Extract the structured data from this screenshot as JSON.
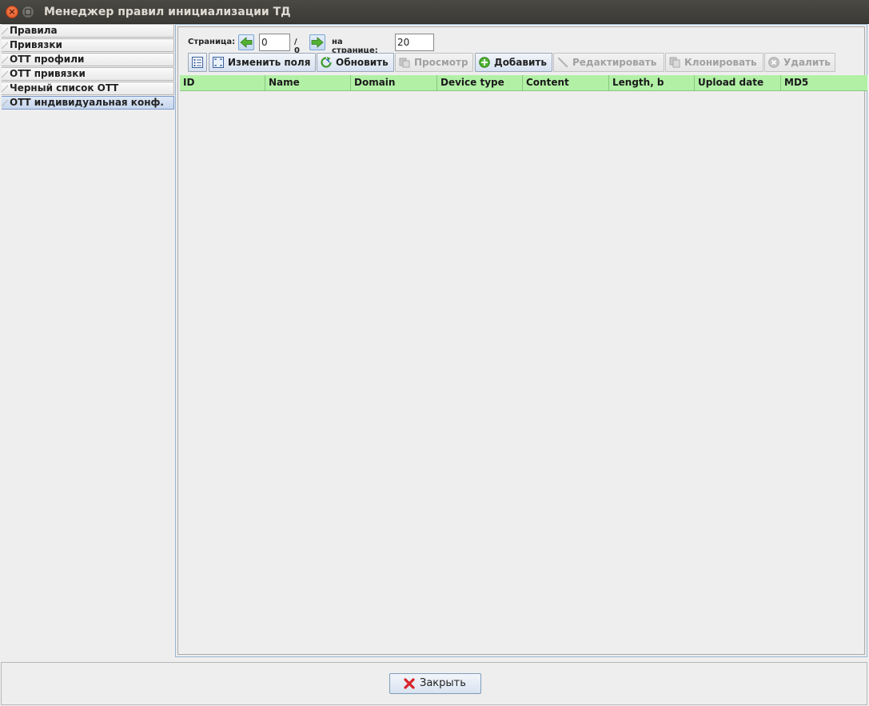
{
  "window": {
    "title": "Менеджер правил инициализации ТД",
    "close_glyph": "×"
  },
  "sidebar": {
    "items": [
      {
        "label": "Правила"
      },
      {
        "label": "Привязки"
      },
      {
        "label": "ОТТ профили"
      },
      {
        "label": "ОТТ привязки"
      },
      {
        "label": "Черный список ОТТ"
      },
      {
        "label": "ОТТ индивидуальная конф.",
        "active": true
      }
    ]
  },
  "pager": {
    "page_label": "Страница:",
    "page_value": "0",
    "total_label": "/ 0",
    "per_page_label": "на странице:",
    "per_page_value": "20"
  },
  "toolbar": {
    "edit_fields": "Изменить поля",
    "refresh": "Обновить",
    "view": "Просмотр",
    "add": "Добавить",
    "edit": "Редактировать",
    "clone": "Клонировать",
    "delete": "Удалить"
  },
  "table": {
    "columns": [
      "ID",
      "Name",
      "Domain",
      "Device type",
      "Content",
      "Length, b",
      "Upload date",
      "MD5"
    ],
    "rows": []
  },
  "footer": {
    "close_label": "Закрыть"
  },
  "colors": {
    "header_green": "#b2f0a6",
    "accent_blue": "#99b4d1",
    "titlebar": "#3b3a36"
  }
}
